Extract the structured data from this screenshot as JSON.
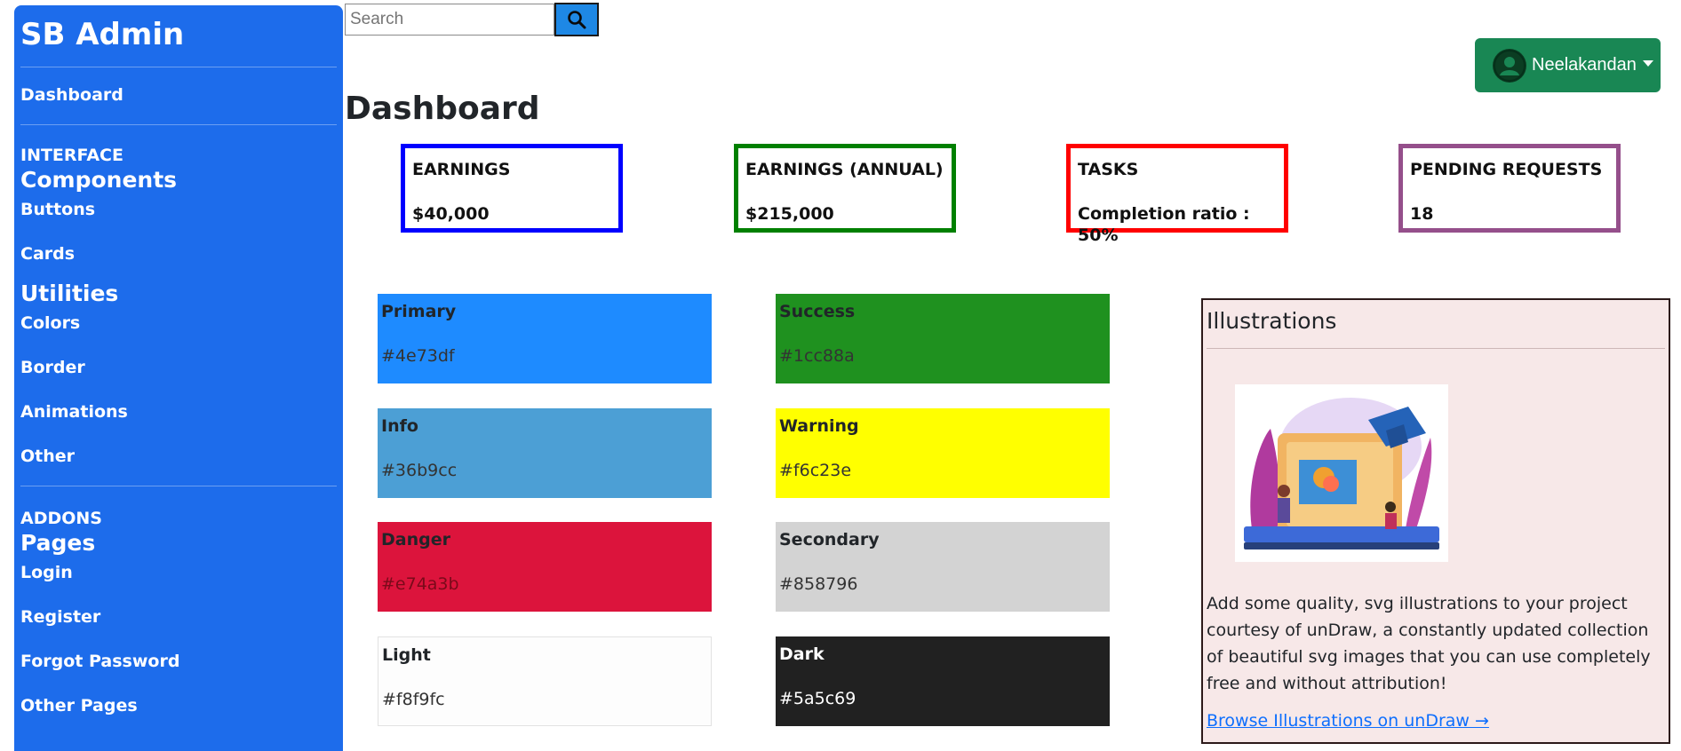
{
  "sidebar": {
    "brand": "SB Admin",
    "dashboard": "Dashboard",
    "interface_heading": "INTERFACE",
    "components_heading": "Components",
    "buttons": "Buttons",
    "cards": "Cards",
    "utilities_heading": "Utilities",
    "colors": "Colors",
    "border": "Border",
    "animations": "Animations",
    "other": "Other",
    "addons_heading": "ADDONS",
    "pages_heading": "Pages",
    "login": "Login",
    "register": "Register",
    "forgot_password": "Forgot Password",
    "other_pages": "Other Pages"
  },
  "search": {
    "placeholder": "Search",
    "icon": "search-icon"
  },
  "user": {
    "name": "Neelakandan",
    "icon": "user-avatar-icon"
  },
  "page_title": "Dashboard",
  "stats": [
    {
      "label": "EARNINGS",
      "value": "$40,000",
      "color": "#0000ff"
    },
    {
      "label": "EARNINGS (ANNUAL)",
      "value": "$215,000",
      "color": "#008000"
    },
    {
      "label": "TASKS",
      "value": "Completion ratio : 50%",
      "color": "#ff0000"
    },
    {
      "label": "PENDING REQUESTS",
      "value": "18",
      "color": "#954f8b"
    }
  ],
  "tiles": [
    {
      "name": "Primary",
      "hex": "#4e73df",
      "bg": "#1e8bff"
    },
    {
      "name": "Success",
      "hex": "#1cc88a",
      "bg": "#1f911f"
    },
    {
      "name": "Info",
      "hex": "#36b9cc",
      "bg": "#4c9fd5"
    },
    {
      "name": "Warning",
      "hex": "#f6c23e",
      "bg": "#ffff00"
    },
    {
      "name": "Danger",
      "hex": "#e74a3b",
      "bg": "#dc143c"
    },
    {
      "name": "Secondary",
      "hex": "#858796",
      "bg": "#d3d3d3"
    },
    {
      "name": "Light",
      "hex": "#f8f9fc",
      "bg": "#fdfdfd"
    },
    {
      "name": "Dark",
      "hex": "#5a5c69",
      "bg": "#212121"
    }
  ],
  "illustrations": {
    "title": "Illustrations",
    "text": "Add some quality, svg illustrations to your project courtesy of unDraw, a constantly updated collection of beautiful svg images that you can use completely free and without attribution!",
    "link": "Browse Illustrations on unDraw →"
  }
}
